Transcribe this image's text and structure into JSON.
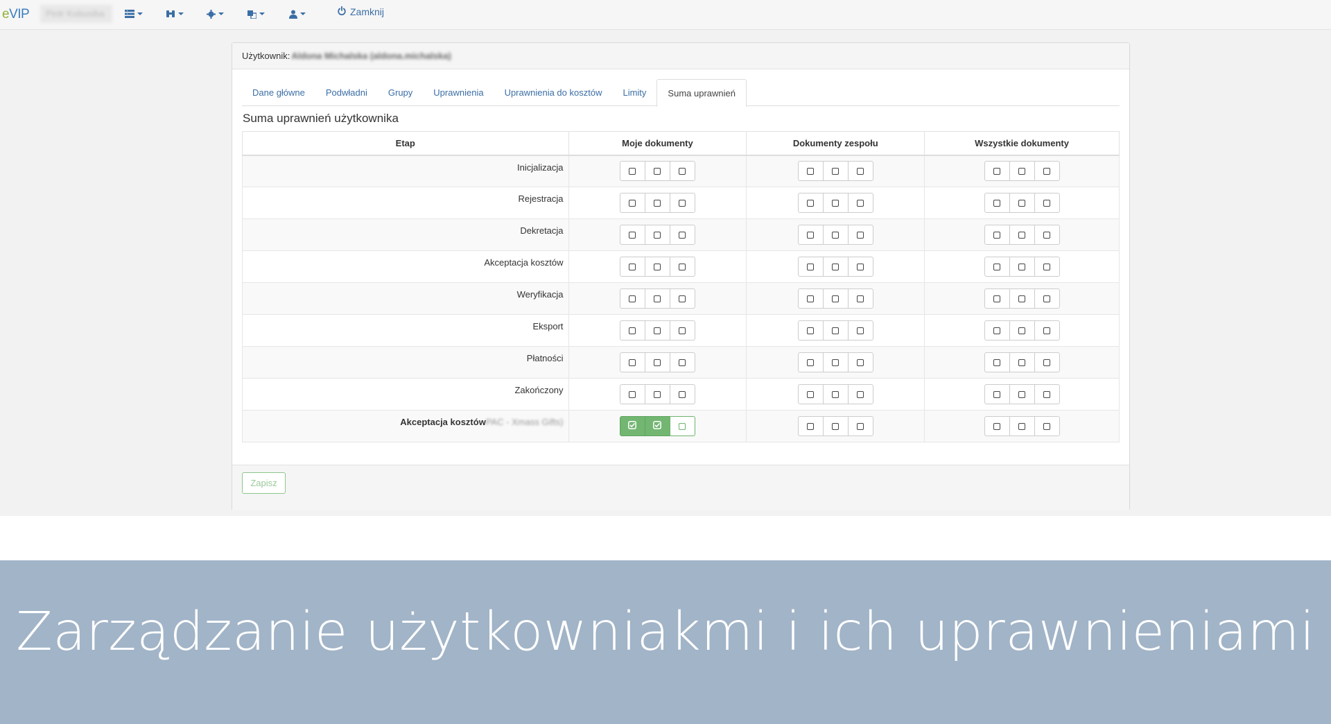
{
  "nav": {
    "brand_e": "e",
    "brand_vip": "VIP",
    "user": "Piotr Kobusiba",
    "close_label": "Zamknij"
  },
  "panel": {
    "user_label": "Użytkownik:",
    "user_value": "Aldona Michalska (aldona.michalska)"
  },
  "tabs": [
    {
      "label": "Dane główne"
    },
    {
      "label": "Podwładni"
    },
    {
      "label": "Grupy"
    },
    {
      "label": "Uprawnienia"
    },
    {
      "label": "Uprawnienia do kosztów"
    },
    {
      "label": "Limity"
    },
    {
      "label": "Suma uprawnień",
      "active": true
    }
  ],
  "section_title": "Suma uprawnień użytkownika",
  "table": {
    "headers": [
      "Etap",
      "Moje dokumenty",
      "Dokumenty zespołu",
      "Wszystkie dokumenty"
    ],
    "rows": [
      {
        "stage": "Inicjalizacja",
        "blurred_suffix": "",
        "bold": false,
        "moje": [
          0,
          0,
          0
        ],
        "zespol": [
          0,
          0,
          0
        ],
        "wszystkie": [
          0,
          0,
          0
        ]
      },
      {
        "stage": "Rejestracja",
        "blurred_suffix": "",
        "bold": false,
        "moje": [
          0,
          0,
          0
        ],
        "zespol": [
          0,
          0,
          0
        ],
        "wszystkie": [
          0,
          0,
          0
        ]
      },
      {
        "stage": "Dekretacja",
        "blurred_suffix": "",
        "bold": false,
        "moje": [
          0,
          0,
          0
        ],
        "zespol": [
          0,
          0,
          0
        ],
        "wszystkie": [
          0,
          0,
          0
        ]
      },
      {
        "stage": "Akceptacja kosztów",
        "blurred_suffix": "",
        "bold": false,
        "moje": [
          0,
          0,
          0
        ],
        "zespol": [
          0,
          0,
          0
        ],
        "wszystkie": [
          0,
          0,
          0
        ]
      },
      {
        "stage": "Weryfikacja",
        "blurred_suffix": "",
        "bold": false,
        "moje": [
          0,
          0,
          0
        ],
        "zespol": [
          0,
          0,
          0
        ],
        "wszystkie": [
          0,
          0,
          0
        ]
      },
      {
        "stage": "Eksport",
        "blurred_suffix": "",
        "bold": false,
        "moje": [
          0,
          0,
          0
        ],
        "zespol": [
          0,
          0,
          0
        ],
        "wszystkie": [
          0,
          0,
          0
        ]
      },
      {
        "stage": "Płatności",
        "blurred_suffix": "",
        "bold": false,
        "moje": [
          0,
          0,
          0
        ],
        "zespol": [
          0,
          0,
          0
        ],
        "wszystkie": [
          0,
          0,
          0
        ]
      },
      {
        "stage": "Zakończony",
        "blurred_suffix": "",
        "bold": false,
        "moje": [
          0,
          0,
          0
        ],
        "zespol": [
          0,
          0,
          0
        ],
        "wszystkie": [
          0,
          0,
          0
        ]
      },
      {
        "stage": "Akceptacja kosztów",
        "blurred_suffix": "PAC - Xmass Gifts)",
        "bold": true,
        "moje": [
          1,
          1,
          2
        ],
        "zespol": [
          0,
          0,
          0
        ],
        "wszystkie": [
          0,
          0,
          0
        ]
      }
    ]
  },
  "save_label": "Zapisz",
  "banner_text": "Zarządzanie użytkowniakmi i ich uprawnieniami",
  "colors": {
    "link": "#3b6ea5",
    "checked_fill": "#72b672",
    "banner_bg": "#a2b4c7"
  }
}
